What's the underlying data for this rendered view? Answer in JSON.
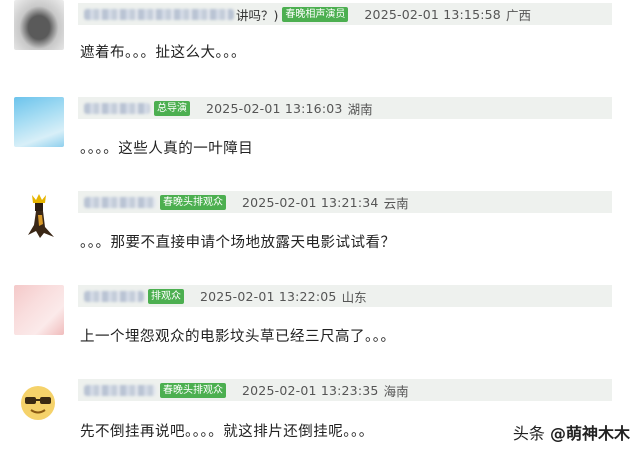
{
  "comments": [
    {
      "name_tail": "讲吗？)",
      "badge": "春晚相声演员",
      "time": "2025-02-01 13:15:58",
      "region": "广西",
      "text": "遮着布。。。扯这么大。。。"
    },
    {
      "name_tail": "",
      "badge": "总导演",
      "time": "2025-02-01 13:16:03",
      "region": "湖南",
      "text": "。。。。这些人真的一叶障目"
    },
    {
      "name_tail": "",
      "badge": "春晚头排观众",
      "time": "2025-02-01 13:21:34",
      "region": "云南",
      "text": "。。。那要不直接申请个场地放露天电影试试看？"
    },
    {
      "name_tail": "",
      "badge": "排观众",
      "time": "2025-02-01 13:22:05",
      "region": "山东",
      "text": "上一个埋怨观众的电影坟头草已经三尺高了。。。"
    },
    {
      "name_tail": "",
      "badge": "春晚头排观众",
      "time": "2025-02-01 13:23:35",
      "region": "海南",
      "text": "先不倒挂再说吧。。。。就这排片还倒挂呢。。。"
    }
  ],
  "watermark": {
    "platform": "头条",
    "account": "@萌神木木"
  }
}
